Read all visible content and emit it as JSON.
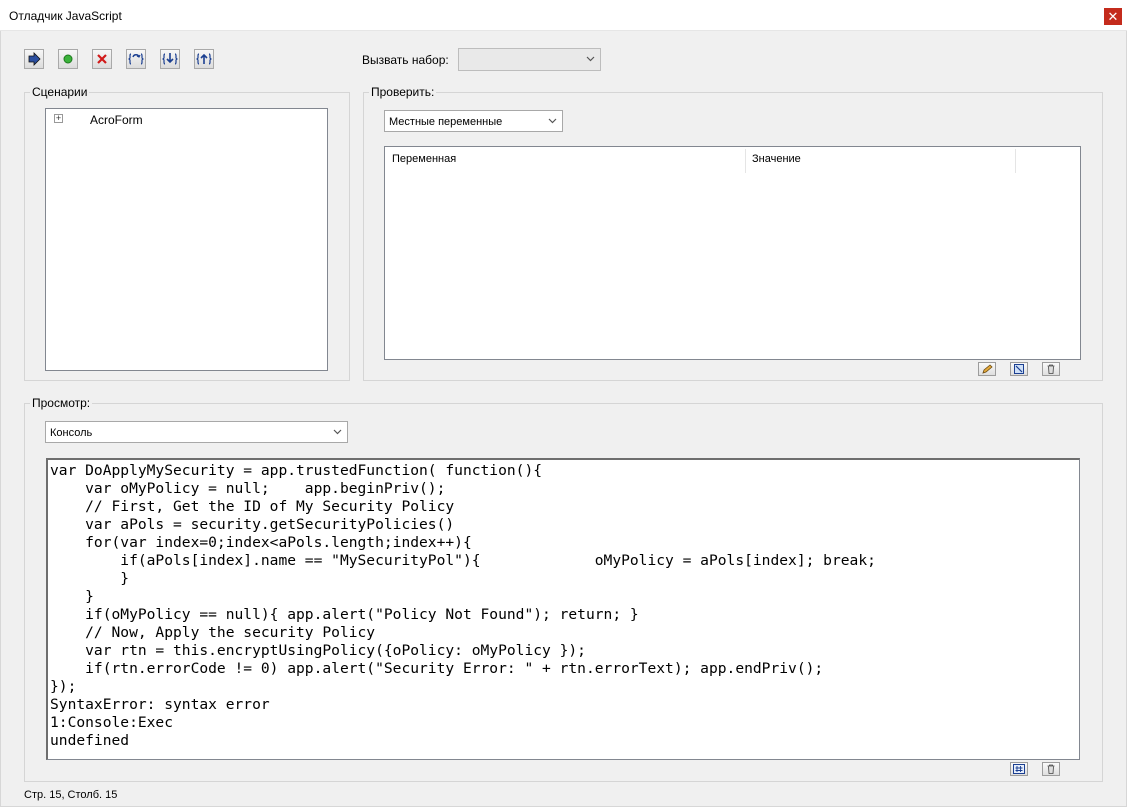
{
  "window": {
    "title": "Отладчик JavaScript",
    "close_glyph": "✕"
  },
  "toolbar": {
    "buttons": [
      {
        "name": "resume-button",
        "icon": "arrow-right-icon"
      },
      {
        "name": "breakpoint-button",
        "icon": "green-dot-icon"
      },
      {
        "name": "quit-button",
        "icon": "red-x-icon"
      },
      {
        "name": "step-over-button",
        "icon": "step-over-icon"
      },
      {
        "name": "step-into-button",
        "icon": "step-into-icon"
      },
      {
        "name": "step-out-button",
        "icon": "step-out-icon"
      }
    ],
    "callstack_label": "Вызвать набор:",
    "callstack_value": ""
  },
  "scripts": {
    "label": "Сценарии",
    "tree": [
      {
        "label": "AcroForm",
        "expander": "+"
      }
    ]
  },
  "inspect": {
    "label": "Проверить:",
    "dropdown_value": "Местные переменные",
    "columns": [
      "Переменная",
      "Значение"
    ]
  },
  "view": {
    "label": "Просмотр:",
    "dropdown_value": "Консоль",
    "console_text": "var DoApplyMySecurity = app.trustedFunction( function(){\n    var oMyPolicy = null;    app.beginPriv();\n    // First, Get the ID of My Security Policy\n    var aPols = security.getSecurityPolicies()\n    for(var index=0;index<aPols.length;index++){\n        if(aPols[index].name == \"MySecurityPol\"){             oMyPolicy = aPols[index]; break;\n        }\n    }\n    if(oMyPolicy == null){ app.alert(\"Policy Not Found\"); return; }\n    // Now, Apply the security Policy\n    var rtn = this.encryptUsingPolicy({oPolicy: oMyPolicy });\n    if(rtn.errorCode != 0) app.alert(\"Security Error: \" + rtn.errorText); app.endPriv();\n});\nSyntaxError: syntax error\n1:Console:Exec\nundefined"
  },
  "status": {
    "text": "Стр. 15, Столб. 15"
  }
}
